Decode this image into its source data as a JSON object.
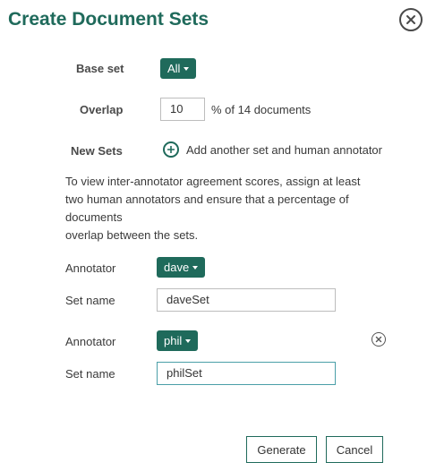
{
  "dialog": {
    "title": "Create Document Sets",
    "close_icon": "close-circle-icon"
  },
  "base_set": {
    "label": "Base set",
    "value": "All"
  },
  "overlap": {
    "label": "Overlap",
    "value": "10",
    "suffix": "% of 14 documents"
  },
  "new_sets": {
    "label": "New Sets",
    "add_label": "Add another set and human annotator",
    "add_icon": "plus-circle-icon"
  },
  "info_lines": [
    "To view inter-annotator agreement scores, assign at least",
    "two human annotators and ensure that a percentage of",
    "documents",
    "overlap between the sets."
  ],
  "sets": [
    {
      "annotator_label": "Annotator",
      "annotator": "dave",
      "setname_label": "Set name",
      "setname": "daveSet"
    },
    {
      "annotator_label": "Annotator",
      "annotator": "phil",
      "setname_label": "Set name",
      "setname": "philSet"
    }
  ],
  "footer": {
    "generate": "Generate",
    "cancel": "Cancel"
  },
  "colors": {
    "primary": "#1f6a5b",
    "focus_border": "#4b9fa8"
  }
}
